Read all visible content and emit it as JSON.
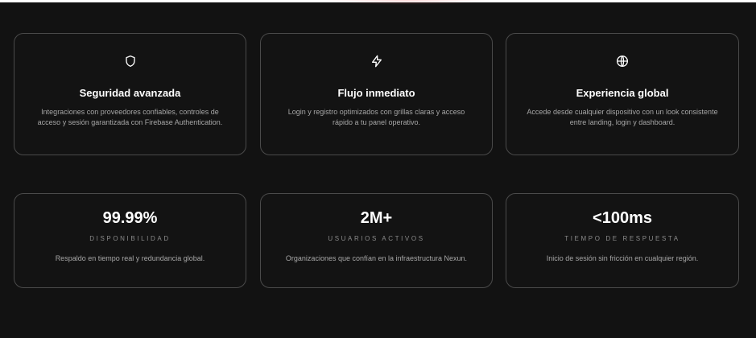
{
  "features": [
    {
      "icon": "shield-icon",
      "title": "Seguridad avanzada",
      "description": "Integraciones con proveedores confiables, controles de acceso y sesión garantizada con Firebase Authentication."
    },
    {
      "icon": "lightning-icon",
      "title": "Flujo inmediato",
      "description": "Login y registro optimizados con grillas claras y acceso rápido a tu panel operativo."
    },
    {
      "icon": "globe-icon",
      "title": "Experiencia global",
      "description": "Accede desde cualquier dispositivo con un look consistente entre landing, login y dashboard."
    }
  ],
  "stats": [
    {
      "value": "99.99%",
      "label": "DISPONIBILIDAD",
      "description": "Respaldo en tiempo real y redundancia global."
    },
    {
      "value": "2M+",
      "label": "USUARIOS ACTIVOS",
      "description": "Organizaciones que confían en la infraestructura Nexun."
    },
    {
      "value": "<100ms",
      "label": "TIEMPO DE RESPUESTA",
      "description": "Inicio de sesión sin fricción en cualquier región."
    }
  ],
  "colors": {
    "background": "#121212",
    "card_border": "#4a4a4a",
    "title": "#ffffff",
    "muted_text": "#a6a6a6"
  }
}
